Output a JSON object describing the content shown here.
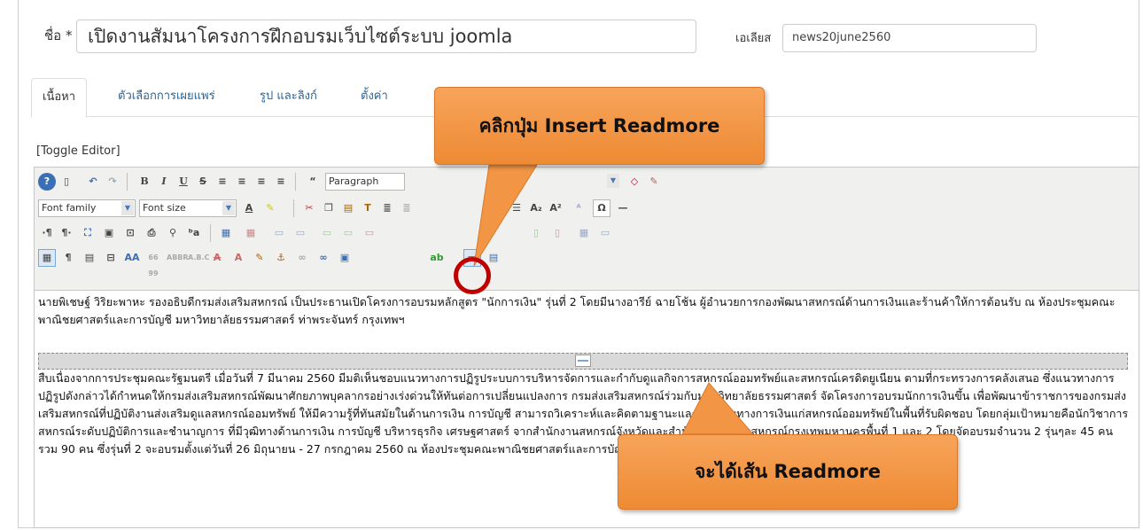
{
  "form": {
    "title_label": "ชื่อ *",
    "title_value": "เปิดงานสัมนาโครงการฝึกอบรมเว็บไซต์ระบบ joomla",
    "alias_label": "เอเลียส",
    "alias_value": "news20june2560"
  },
  "tabs": [
    {
      "label": "เนื้อหา",
      "active": true
    },
    {
      "label": "ตัวเลือกการเผยแพร่",
      "active": false
    },
    {
      "label": "รูป และลิงก์",
      "active": false
    },
    {
      "label": "ตั้งค่า",
      "active": false
    }
  ],
  "toggle_editor": "[Toggle Editor]",
  "toolbar": {
    "format_select": "Paragraph",
    "font_family": "Font family",
    "font_size": "Font size"
  },
  "content": {
    "paragraph1": "นายพิเชษฐ์ วิริยะพาหะ รองอธิบดีกรมส่งเสริมสหกรณ์ เป็นประธานเปิดโครงการอบรมหลักสูตร \"นักการเงิน\" รุ่นที่ 2 โดยมีนางอารีย์ ฉายโช้น ผู้อำนวยการกองพัฒนาสหกรณ์ด้านการเงินและร้านค้าให้การต้อนรับ ณ ห้องประชุมคณะพาณิชยศาสตร์และการบัญชี มหาวิทยาลัยธรรมศาสตร์ ท่าพระจันทร์ กรุงเทพฯ",
    "paragraph2": "สืบเนื่องจากการประชุมคณะรัฐมนตรี เมื่อวันที่ 7 มีนาคม 2560 มีมติเห็นชอบแนวทางการปฏิรูประบบการบริหารจัดการและกำกับดูแลกิจการสหกรณ์ออมทรัพย์และสหกรณ์เครดิตยูเนียน ตามที่กระทรวงการคลังเสนอ ซึ่งแนวทางการปฏิรูปดังกล่าวได้กำหนดให้กรมส่งเสริมสหกรณ์พัฒนาศักยภาพบุคลากรอย่างเร่งด่วนให้ทันต่อการเปลี่ยนแปลงการ กรมส่งเสริมสหกรณ์ร่วมกับมหาวิทยาลัยธรรมศาสตร์ จัดโครงการอบรมนักการเงินขึ้น เพื่อพัฒนาข้าราชการของกรมส่งเสริมสหกรณ์ที่ปฏิบัติงานส่งเสริมดูแลสหกรณ์ออมทรัพย์ ให้มีความรู้ที่ทันสมัยในด้านการเงิน การบัญชี สามารถวิเคราะห์และคิดตามฐานะและเตือนภัยทางการเงินแก่สหกรณ์ออมทรัพย์ในพื้นที่รับผิดชอบ โดยกลุ่มเป้าหมายคือนักวิชาการสหกรณ์ระดับปฏิบัติการและชำนาญการ ที่มีวุฒิทางด้านการเงิน การบัญชี บริหารธุรกิจ เศรษฐศาสตร์ จากสำนักงานสหกรณ์จังหวัดและสำนักงานส่งเสริมสหกรณ์กรุงเทพมหานครพื้นที่ 1 และ 2 โดยจัดอบรมจำนวน 2 รุ่นๆละ 45 คน รวม 90 คน ซึ่งรุ่นที่ 2 จะอบรมตั้งแต่วันที่ 26 มิถุนายน - 27 กรกฎาคม 2560 ณ ห้องประชุมคณะพาณิชยศาสตร์และการบัญชี มหาวิทยาลัยธรรมศาสตร์ ท่าพระจันทร์ กรุงเทพฯ"
  },
  "callouts": {
    "top": "คลิกปุ่ม Insert Readmore",
    "bottom": "จะได้เส้น Readmore"
  },
  "colors": {
    "callout": "#f39a48",
    "highlight_ring": "#c00000",
    "link": "#2a6496"
  }
}
